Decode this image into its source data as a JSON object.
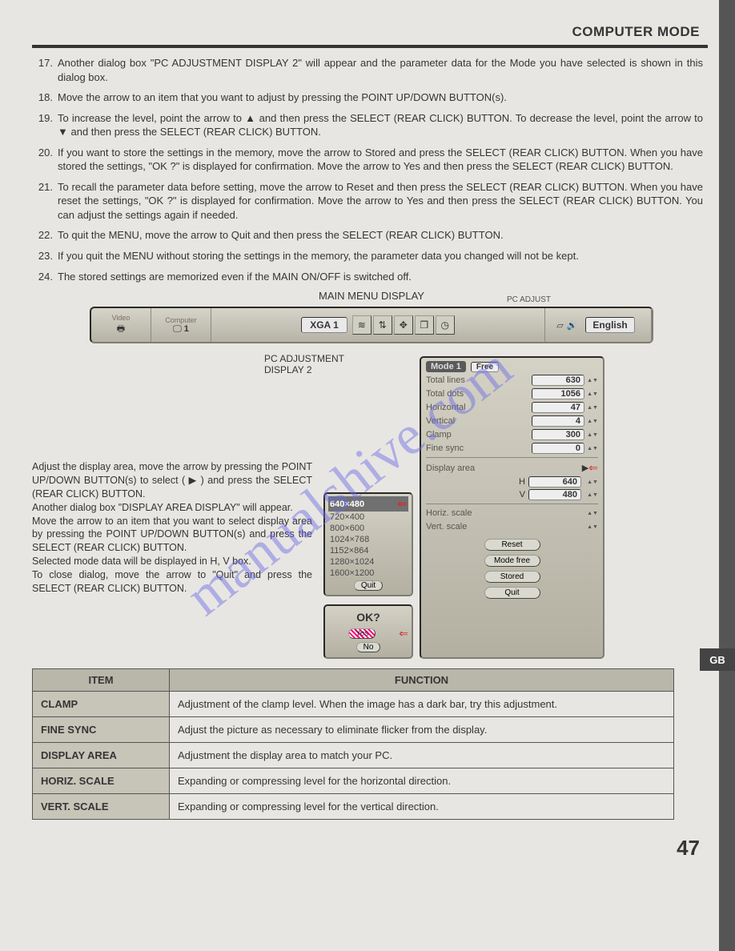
{
  "header": {
    "title": "COMPUTER MODE"
  },
  "instructions": {
    "i17": {
      "num": "17.",
      "text": "Another dialog box \"PC ADJUSTMENT DISPLAY 2\" will appear and the parameter data for the Mode you have selected is shown in this dialog box."
    },
    "i18": {
      "num": "18.",
      "text": "Move the arrow to an item that you want to adjust by pressing the POINT UP/DOWN BUTTON(s)."
    },
    "i19": {
      "num": "19.",
      "text": "To increase the level, point the arrow to ▲ and then press the SELECT (REAR CLICK) BUTTON. To decrease the level, point the arrow to ▼ and then press the SELECT (REAR CLICK) BUTTON."
    },
    "i20": {
      "num": "20.",
      "text": "If you want to store the settings in the memory, move the arrow to Stored and press the SELECT (REAR CLICK) BUTTON. When you have stored the settings, \"OK ?\" is displayed for confirmation. Move the arrow to Yes and then press the SELECT (REAR CLICK) BUTTON."
    },
    "i21": {
      "num": "21.",
      "text": "To recall the parameter data before setting, move the arrow to Reset and then press the SELECT (REAR CLICK) BUTTON. When you have reset the settings, \"OK ?\" is displayed for confirmation. Move the arrow to Yes and then press the SELECT (REAR CLICK) BUTTON. You can adjust the settings again if needed."
    },
    "i22": {
      "num": "22.",
      "text": "To quit the MENU, move the arrow to Quit and then press the SELECT (REAR CLICK) BUTTON."
    },
    "i23": {
      "num": "23.",
      "text": "If you quit the MENU without storing the settings in the memory, the parameter data you changed will not be kept."
    },
    "i24": {
      "num": "24.",
      "text": "The stored settings are memorized even if the MAIN ON/OFF is switched off."
    }
  },
  "mainMenu": {
    "label": "MAIN MENU DISPLAY",
    "video": "Video",
    "computer": "Computer",
    "one": "1",
    "xga": "XGA 1",
    "pcadjust": "PC ADJUST",
    "english": "English"
  },
  "pcAdjLabel": {
    "line1": "PC ADJUSTMENT",
    "line2": "DISPLAY 2"
  },
  "leftText": {
    "p1": "Adjust the display area, move the arrow by pressing the POINT UP/DOWN BUTTON(s) to select ( ▶ ) and press the SELECT (REAR CLICK) BUTTON.",
    "p2": "Another dialog box \"DISPLAY AREA DISPLAY\" will appear.",
    "p3": "Move the arrow to an item that you want to select display area by pressing the POINT UP/DOWN BUTTON(s) and press the SELECT (REAR CLICK) BUTTON.",
    "p4": "Selected mode data will be displayed in H, V box.",
    "p5": "To close dialog, move the arrow to \"Quit\" and press the SELECT (REAR CLICK) BUTTON."
  },
  "resolutions": {
    "r0": "640×480",
    "r1": "720×400",
    "r2": "800×600",
    "r3": "1024×768",
    "r4": "1152×864",
    "r5": "1280×1024",
    "r6": "1600×1200",
    "quit": "Quit"
  },
  "okDialog": {
    "title": "OK?",
    "yes": "Yes",
    "no": "No"
  },
  "params": {
    "mode": "Mode 1",
    "free": "Free",
    "totalLinesLbl": "Total lines",
    "totalLinesVal": "630",
    "totalDotsLbl": "Total dots",
    "totalDotsVal": "1056",
    "horizontalLbl": "Horizontal",
    "horizontalVal": "47",
    "verticalLbl": "Vertical",
    "verticalVal": "4",
    "clampLbl": "Clamp",
    "clampVal": "300",
    "fineSyncLbl": "Fine sync",
    "fineSyncVal": "0",
    "displayAreaLbl": "Display area",
    "hLbl": "H",
    "hVal": "640",
    "vLbl": "V",
    "vVal": "480",
    "horizScaleLbl": "Horiz. scale",
    "vertScaleLbl": "Vert. scale",
    "reset": "Reset",
    "modeFree": "Mode free",
    "stored": "Stored",
    "quit": "Quit"
  },
  "gb": "GB",
  "table": {
    "itemHeader": "ITEM",
    "functionHeader": "FUNCTION",
    "r0": {
      "item": "CLAMP",
      "func": "Adjustment of the clamp level. When the image has a dark bar, try this adjustment."
    },
    "r1": {
      "item": "FINE SYNC",
      "func": "Adjust the picture as necessary to eliminate flicker from the display."
    },
    "r2": {
      "item": "DISPLAY AREA",
      "func": "Adjustment the display area to match your PC."
    },
    "r3": {
      "item": "HORIZ. SCALE",
      "func": "Expanding or compressing level for the horizontal direction."
    },
    "r4": {
      "item": "VERT. SCALE",
      "func": "Expanding or compressing level for the vertical direction."
    }
  },
  "pageNumber": "47",
  "watermark": "manualshive.com"
}
